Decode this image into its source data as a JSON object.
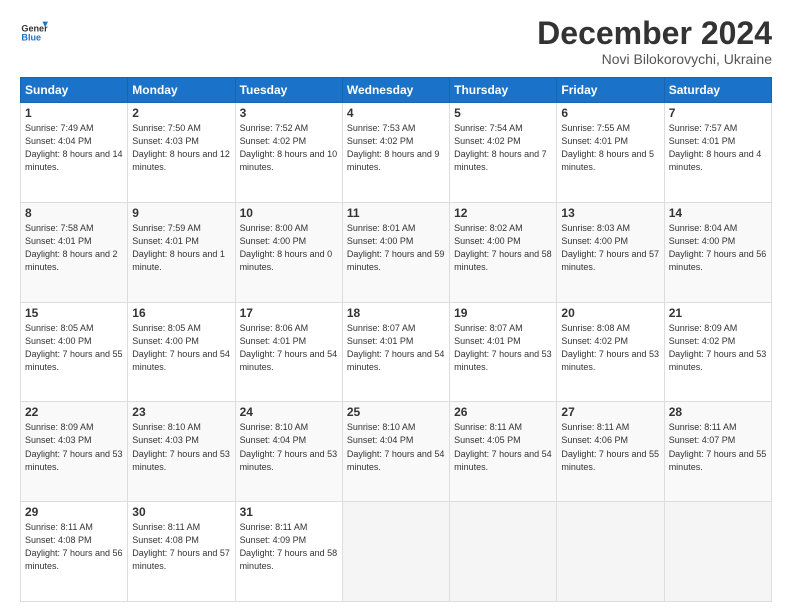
{
  "logo": {
    "line1": "General",
    "line2": "Blue"
  },
  "header": {
    "month": "December 2024",
    "location": "Novi Bilokorovychi, Ukraine"
  },
  "weekdays": [
    "Sunday",
    "Monday",
    "Tuesday",
    "Wednesday",
    "Thursday",
    "Friday",
    "Saturday"
  ],
  "weeks": [
    [
      {
        "day": "1",
        "sunrise": "7:49 AM",
        "sunset": "4:04 PM",
        "daylight": "8 hours and 14 minutes."
      },
      {
        "day": "2",
        "sunrise": "7:50 AM",
        "sunset": "4:03 PM",
        "daylight": "8 hours and 12 minutes."
      },
      {
        "day": "3",
        "sunrise": "7:52 AM",
        "sunset": "4:02 PM",
        "daylight": "8 hours and 10 minutes."
      },
      {
        "day": "4",
        "sunrise": "7:53 AM",
        "sunset": "4:02 PM",
        "daylight": "8 hours and 9 minutes."
      },
      {
        "day": "5",
        "sunrise": "7:54 AM",
        "sunset": "4:02 PM",
        "daylight": "8 hours and 7 minutes."
      },
      {
        "day": "6",
        "sunrise": "7:55 AM",
        "sunset": "4:01 PM",
        "daylight": "8 hours and 5 minutes."
      },
      {
        "day": "7",
        "sunrise": "7:57 AM",
        "sunset": "4:01 PM",
        "daylight": "8 hours and 4 minutes."
      }
    ],
    [
      {
        "day": "8",
        "sunrise": "7:58 AM",
        "sunset": "4:01 PM",
        "daylight": "8 hours and 2 minutes."
      },
      {
        "day": "9",
        "sunrise": "7:59 AM",
        "sunset": "4:01 PM",
        "daylight": "8 hours and 1 minute."
      },
      {
        "day": "10",
        "sunrise": "8:00 AM",
        "sunset": "4:00 PM",
        "daylight": "8 hours and 0 minutes."
      },
      {
        "day": "11",
        "sunrise": "8:01 AM",
        "sunset": "4:00 PM",
        "daylight": "7 hours and 59 minutes."
      },
      {
        "day": "12",
        "sunrise": "8:02 AM",
        "sunset": "4:00 PM",
        "daylight": "7 hours and 58 minutes."
      },
      {
        "day": "13",
        "sunrise": "8:03 AM",
        "sunset": "4:00 PM",
        "daylight": "7 hours and 57 minutes."
      },
      {
        "day": "14",
        "sunrise": "8:04 AM",
        "sunset": "4:00 PM",
        "daylight": "7 hours and 56 minutes."
      }
    ],
    [
      {
        "day": "15",
        "sunrise": "8:05 AM",
        "sunset": "4:00 PM",
        "daylight": "7 hours and 55 minutes."
      },
      {
        "day": "16",
        "sunrise": "8:05 AM",
        "sunset": "4:00 PM",
        "daylight": "7 hours and 54 minutes."
      },
      {
        "day": "17",
        "sunrise": "8:06 AM",
        "sunset": "4:01 PM",
        "daylight": "7 hours and 54 minutes."
      },
      {
        "day": "18",
        "sunrise": "8:07 AM",
        "sunset": "4:01 PM",
        "daylight": "7 hours and 54 minutes."
      },
      {
        "day": "19",
        "sunrise": "8:07 AM",
        "sunset": "4:01 PM",
        "daylight": "7 hours and 53 minutes."
      },
      {
        "day": "20",
        "sunrise": "8:08 AM",
        "sunset": "4:02 PM",
        "daylight": "7 hours and 53 minutes."
      },
      {
        "day": "21",
        "sunrise": "8:09 AM",
        "sunset": "4:02 PM",
        "daylight": "7 hours and 53 minutes."
      }
    ],
    [
      {
        "day": "22",
        "sunrise": "8:09 AM",
        "sunset": "4:03 PM",
        "daylight": "7 hours and 53 minutes."
      },
      {
        "day": "23",
        "sunrise": "8:10 AM",
        "sunset": "4:03 PM",
        "daylight": "7 hours and 53 minutes."
      },
      {
        "day": "24",
        "sunrise": "8:10 AM",
        "sunset": "4:04 PM",
        "daylight": "7 hours and 53 minutes."
      },
      {
        "day": "25",
        "sunrise": "8:10 AM",
        "sunset": "4:04 PM",
        "daylight": "7 hours and 54 minutes."
      },
      {
        "day": "26",
        "sunrise": "8:11 AM",
        "sunset": "4:05 PM",
        "daylight": "7 hours and 54 minutes."
      },
      {
        "day": "27",
        "sunrise": "8:11 AM",
        "sunset": "4:06 PM",
        "daylight": "7 hours and 55 minutes."
      },
      {
        "day": "28",
        "sunrise": "8:11 AM",
        "sunset": "4:07 PM",
        "daylight": "7 hours and 55 minutes."
      }
    ],
    [
      {
        "day": "29",
        "sunrise": "8:11 AM",
        "sunset": "4:08 PM",
        "daylight": "7 hours and 56 minutes."
      },
      {
        "day": "30",
        "sunrise": "8:11 AM",
        "sunset": "4:08 PM",
        "daylight": "7 hours and 57 minutes."
      },
      {
        "day": "31",
        "sunrise": "8:11 AM",
        "sunset": "4:09 PM",
        "daylight": "7 hours and 58 minutes."
      },
      null,
      null,
      null,
      null
    ]
  ]
}
